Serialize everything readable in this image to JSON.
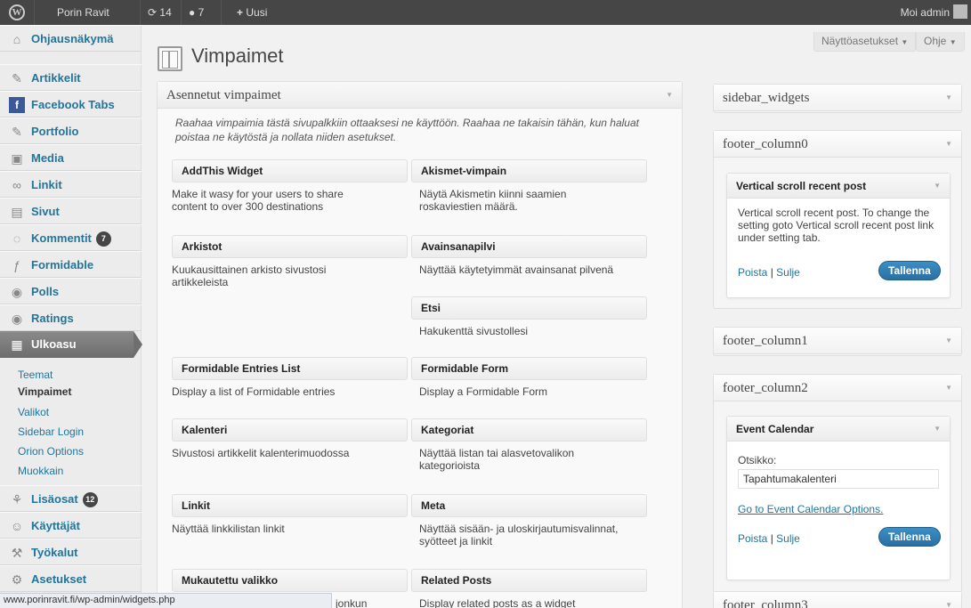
{
  "adminbar": {
    "logo": "W",
    "site_name": "Porin Ravit",
    "updates_count": "14",
    "comments_count": "7",
    "new_label": "Uusi",
    "user_greeting": "Moi admin"
  },
  "sidebar": {
    "items": [
      {
        "label": "Ohjausnäkymä",
        "icon": "home-icon"
      },
      {
        "label": "Artikkelit",
        "icon": "pin-icon"
      },
      {
        "label": "Facebook Tabs",
        "icon": "facebook-icon"
      },
      {
        "label": "Portfolio",
        "icon": "pin-icon"
      },
      {
        "label": "Media",
        "icon": "media-icon"
      },
      {
        "label": "Linkit",
        "icon": "link-icon"
      },
      {
        "label": "Sivut",
        "icon": "pages-icon"
      },
      {
        "label": "Kommentit",
        "icon": "comments-icon",
        "badge": "7"
      },
      {
        "label": "Formidable",
        "icon": "formidable-icon"
      },
      {
        "label": "Polls",
        "icon": "polls-icon"
      },
      {
        "label": "Ratings",
        "icon": "ratings-icon"
      },
      {
        "label": "Ulkoasu",
        "icon": "appearance-icon",
        "active": true
      },
      {
        "label": "Lisäosat",
        "icon": "plugins-icon",
        "badge": "12"
      },
      {
        "label": "Käyttäjät",
        "icon": "users-icon"
      },
      {
        "label": "Työkalut",
        "icon": "tools-icon"
      },
      {
        "label": "Asetukset",
        "icon": "settings-icon"
      }
    ],
    "submenu": [
      "Teemat",
      "Vimpaimet",
      "Valikot",
      "Sidebar Login",
      "Orion Options",
      "Muokkain"
    ]
  },
  "header": {
    "screen_options": "Näyttöasetukset",
    "help": "Ohje",
    "title": "Vimpaimet"
  },
  "available": {
    "title": "Asennetut vimpaimet",
    "description": "Raahaa vimpaimia tästä sivupalkkiin ottaaksesi ne käyttöön. Raahaa ne takaisin tähän, kun haluat poistaa ne käytöstä ja nollata niiden asetukset.",
    "widgets": [
      {
        "name": "AddThis Widget",
        "desc": "Make it wasy for your users to share content to over 300 destinations"
      },
      {
        "name": "Akismet-vimpain",
        "desc": "Näytä Akismetin kiinni saamien roskaviestien määrä."
      },
      {
        "name": "Arkistot",
        "desc": "Kuukausittainen arkisto sivustosi artikkeleista"
      },
      {
        "name": "Avainsanapilvi",
        "desc": "Näyttää käytetyimmät avainsanat pilvenä"
      },
      {
        "name": "Etsi",
        "desc": "Hakukenttä sivustollesi"
      },
      {
        "name": "Formidable Entries List",
        "desc": "Display a list of Formidable entries"
      },
      {
        "name": "Formidable Form",
        "desc": "Display a Formidable Form"
      },
      {
        "name": "Kalenteri",
        "desc": "Sivustosi artikkelit kalenterimuodossa"
      },
      {
        "name": "Kategoriat",
        "desc": "Näyttää listan tai alasvetovalikon kategorioista"
      },
      {
        "name": "Linkit",
        "desc": "Näyttää linkkilistan linkit"
      },
      {
        "name": "Meta",
        "desc": "Näyttää sisään- ja uloskirjautumisvalinnat, syötteet ja linkit"
      },
      {
        "name": "Mukautettu valikko",
        "desc": "jonkun"
      },
      {
        "name": "Related Posts",
        "desc": "Display related posts as a widget"
      }
    ]
  },
  "sidebars": {
    "s0": {
      "title": "sidebar_widgets"
    },
    "s1": {
      "title": "footer_column0",
      "widget_title": "Vertical scroll recent post",
      "widget_text": "Vertical scroll recent post. To change the setting goto Vertical scroll recent post link under setting tab.",
      "delete": "Poista",
      "sep": "|",
      "close": "Sulje",
      "save": "Tallenna"
    },
    "s2": {
      "title": "footer_column1"
    },
    "s3": {
      "title": "footer_column2",
      "widget_title": "Event Calendar",
      "field_label": "Otsikko:",
      "field_value": "Tapahtumakalenteri",
      "options_link": "Go to Event Calendar Options.",
      "delete": "Poista",
      "sep": "|",
      "close": "Sulje",
      "save": "Tallenna"
    },
    "s4": {
      "title": "footer_column3"
    }
  },
  "statusbar": {
    "url": "www.porinravit.fi/wp-admin/widgets.php"
  }
}
